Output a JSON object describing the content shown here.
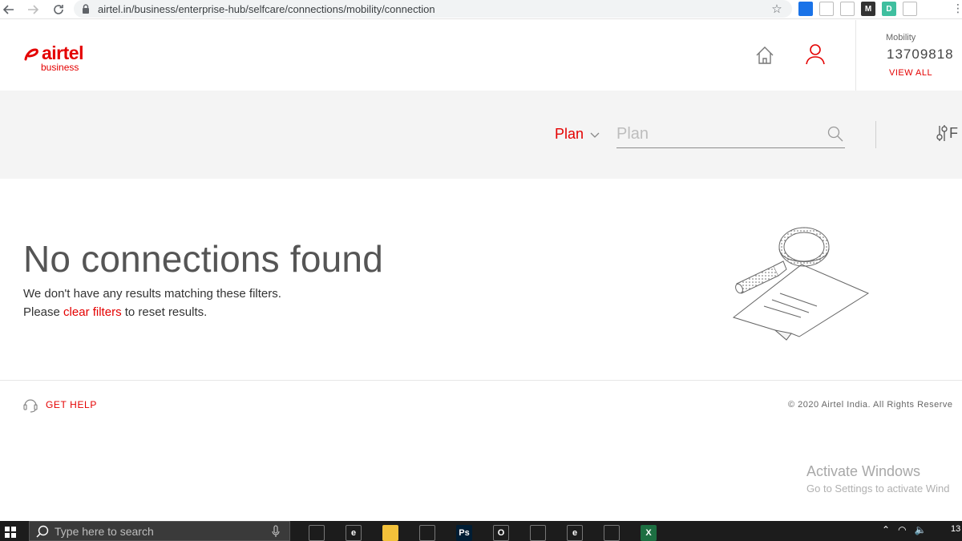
{
  "browser": {
    "url": "airtel.in/business/enterprise-hub/selfcare/connections/mobility/connection",
    "extensions": [
      {
        "name": "extension-1",
        "color": "#1a73e8",
        "glyph": ""
      },
      {
        "name": "extension-2",
        "color": "#ffffff",
        "glyph": ""
      },
      {
        "name": "camera-extension",
        "color": "#ffffff",
        "glyph": ""
      },
      {
        "name": "m-extension",
        "color": "#333333",
        "glyph": "M"
      },
      {
        "name": "d-extension",
        "color": "#3fbf9f",
        "glyph": "D"
      },
      {
        "name": "globe-extension",
        "color": "#ffffff",
        "glyph": ""
      }
    ]
  },
  "brand": {
    "name": "airtel",
    "sub": "business",
    "color": "#e40000"
  },
  "header": {
    "account_type": "Mobility",
    "account_number": "13709818",
    "view_all": "VIEW ALL"
  },
  "filters": {
    "plan_label": "Plan",
    "search_placeholder": "Plan",
    "filter_label": "F"
  },
  "empty_state": {
    "title": "No connections found",
    "message": "We don't have any results matching these filters.",
    "prefix": "Please ",
    "link": "clear filters",
    "suffix": " to reset results."
  },
  "footer": {
    "help": "GET HELP",
    "copyright": "© 2020 Airtel India. All Rights Reserve"
  },
  "watermark": {
    "title": "Activate Windows",
    "subtitle": "Go to Settings to activate Wind"
  },
  "taskbar": {
    "search_placeholder": "Type here to search",
    "clock": "13",
    "apps": [
      {
        "name": "task-view-app",
        "color": "#1c1c1c",
        "glyph": ""
      },
      {
        "name": "internet-explorer-app",
        "color": "#1c1c1c",
        "glyph": "e"
      },
      {
        "name": "file-explorer-app",
        "color": "#f3c13a",
        "glyph": ""
      },
      {
        "name": "calculator-app",
        "color": "#1c1c1c",
        "glyph": ""
      },
      {
        "name": "photoshop-app",
        "color": "#001d34",
        "glyph": "Ps"
      },
      {
        "name": "opera-app",
        "color": "#1c1c1c",
        "glyph": "O"
      },
      {
        "name": "chrome-app",
        "color": "#1c1c1c",
        "glyph": ""
      },
      {
        "name": "edge-app",
        "color": "#1c1c1c",
        "glyph": "e"
      },
      {
        "name": "pen-app",
        "color": "#1c1c1c",
        "glyph": ""
      },
      {
        "name": "excel-app",
        "color": "#1d6f42",
        "glyph": "X"
      }
    ]
  }
}
